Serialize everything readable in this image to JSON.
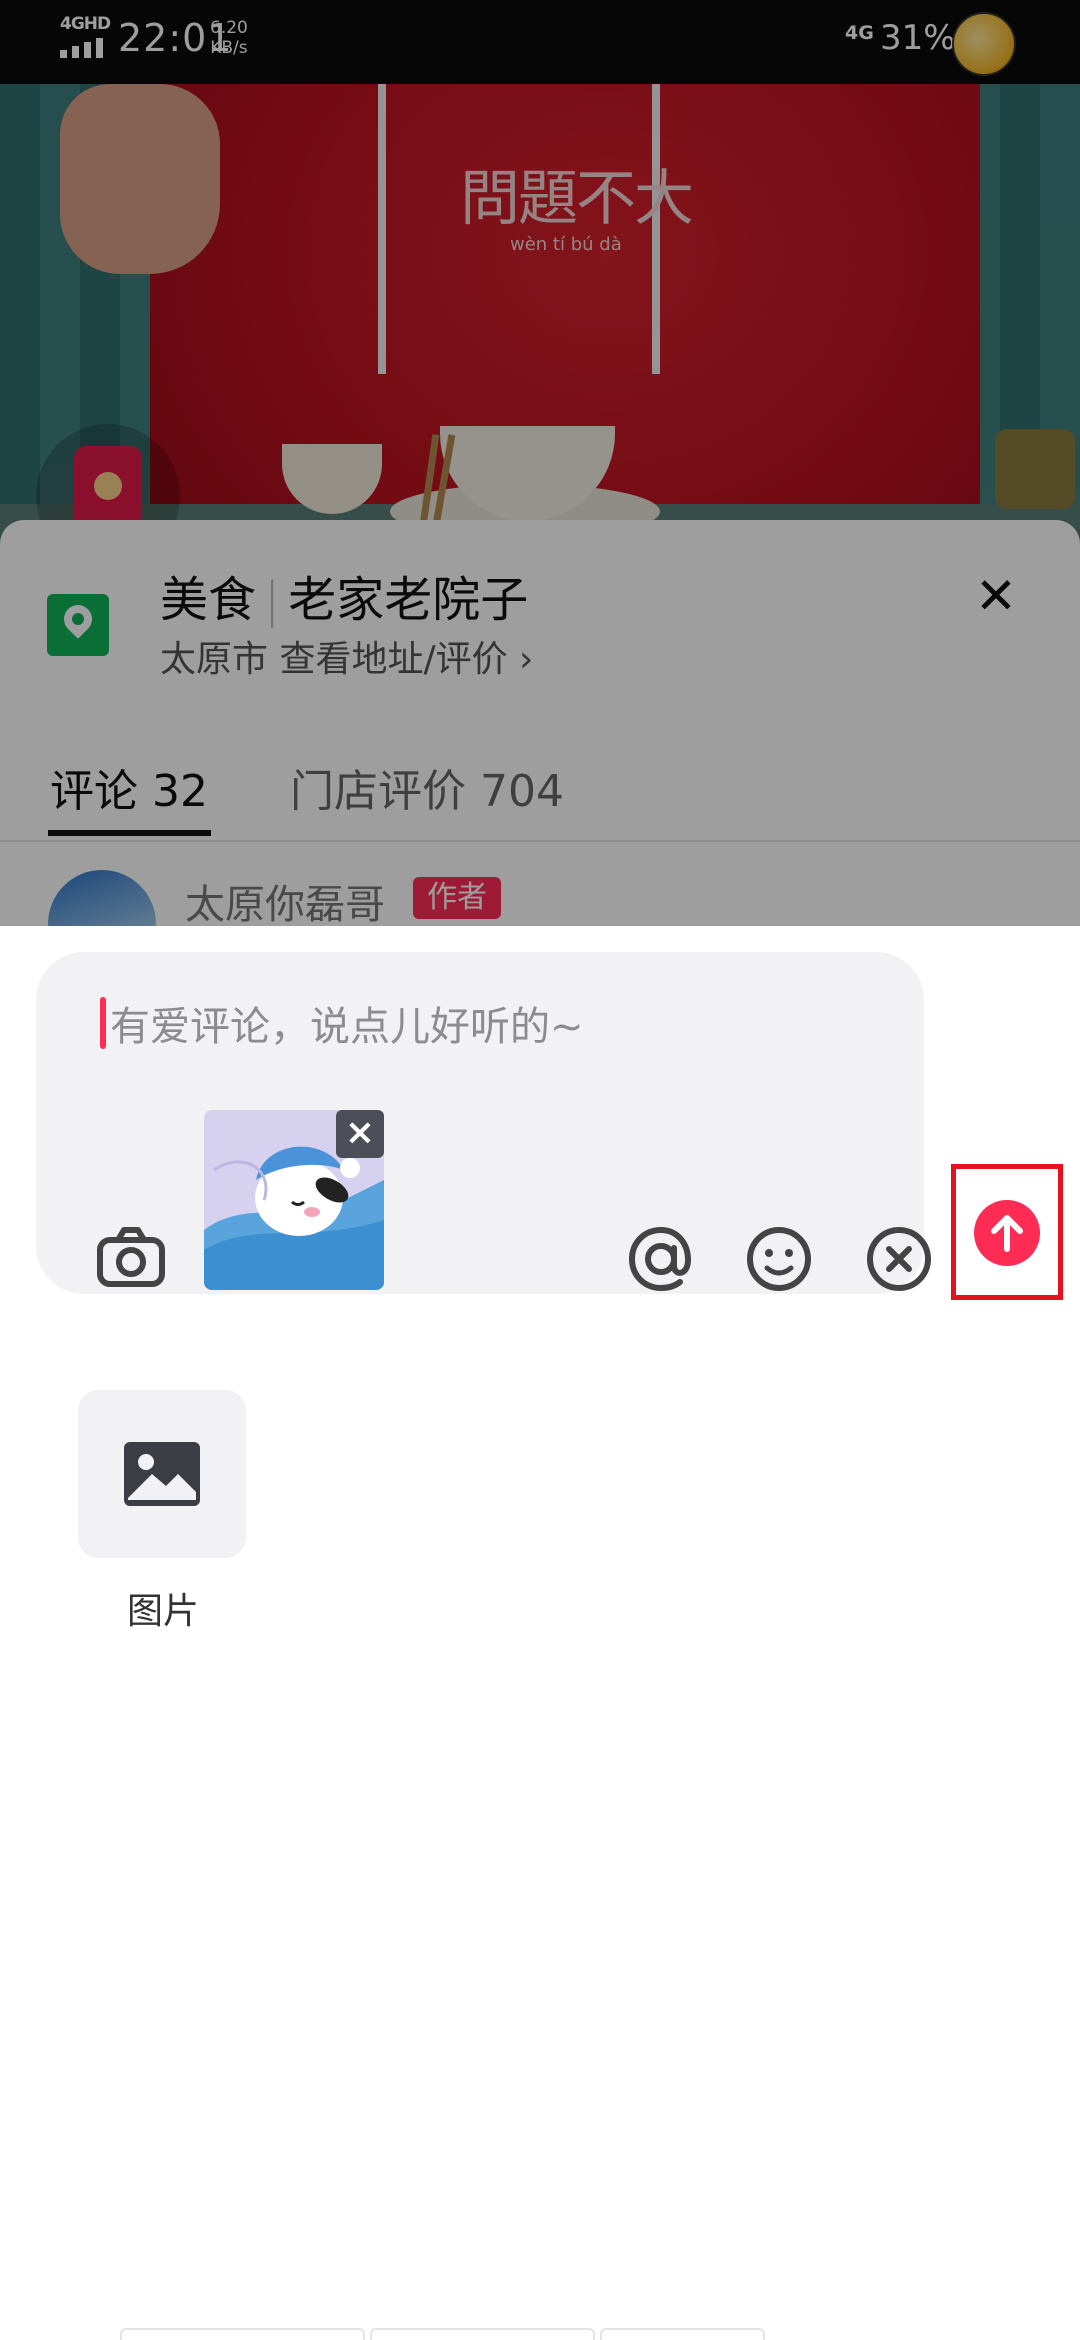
{
  "status_bar": {
    "network_left": "4GHD",
    "time": "22:01",
    "speed_value": "6.20",
    "speed_unit": "KB/s",
    "network_right": "4G",
    "battery": "31%"
  },
  "video": {
    "hoodie_print": "問題不大",
    "hoodie_pinyin": "wèn tí bú dà"
  },
  "poi": {
    "category": "美食",
    "name": "老家老院子",
    "city_line": "太原市 查看地址/评价 ›",
    "close_icon": "close-icon"
  },
  "tabs": [
    {
      "label": "评论 32",
      "active": true
    },
    {
      "label": "门店评价 704",
      "active": false
    }
  ],
  "comment_preview": {
    "user": "太原你磊哥",
    "badge": "作者"
  },
  "input": {
    "placeholder": "有爱评论，说点儿好听的~",
    "sticker_remove": "×",
    "tools": [
      "camera-icon",
      "at-icon",
      "emoji-icon",
      "clear-icon"
    ]
  },
  "send": {
    "icon": "arrow-up-icon",
    "color": "#fe2c55",
    "highlight_color": "#e4121f"
  },
  "panel": {
    "image_label": "图片"
  }
}
